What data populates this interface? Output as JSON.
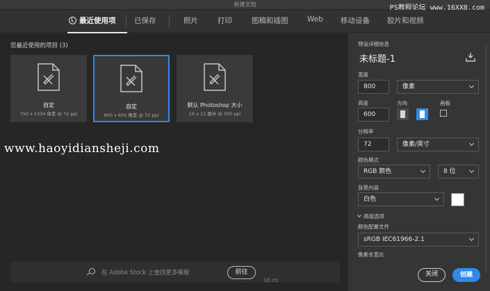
{
  "window": {
    "title": "新建文档"
  },
  "watermark_top": "PS教程论坛 www.16XX8.com",
  "tabs": [
    {
      "label": "最近使用项"
    },
    {
      "label": "已保存"
    },
    {
      "label": "照片"
    },
    {
      "label": "打印"
    },
    {
      "label": "图稿和插图"
    },
    {
      "label": "Web"
    },
    {
      "label": "移动设备"
    },
    {
      "label": "胶片和视频"
    }
  ],
  "recent": {
    "title": "您最近使用的项目 (3)",
    "items": [
      {
        "name": "自定",
        "meta": "750 x 1334 像素 @ 72 ppi"
      },
      {
        "name": "自定",
        "meta": "800 x 600 像素 @ 72 ppi"
      },
      {
        "name": "默认 Photoshop 大小",
        "meta": "16 x 12 厘米 @ 300 ppi"
      }
    ]
  },
  "watermark_mid": "www.haoyidiansheji.com",
  "search": {
    "placeholder": "在 Adobe Stock 上查找更多模板",
    "go_label": "前往"
  },
  "logo_mark": "UI.cn",
  "preset": {
    "section_label": "预设详细信息",
    "name": "未标题-1",
    "width_label": "宽度",
    "width_value": "800",
    "width_unit": "像素",
    "height_label": "高度",
    "height_value": "600",
    "orientation_label": "方向",
    "artboard_label": "画板",
    "resolution_label": "分辨率",
    "resolution_value": "72",
    "resolution_unit": "像素/英寸",
    "color_mode_label": "颜色模式",
    "color_mode_value": "RGB 颜色",
    "bit_depth_value": "8 位",
    "background_label": "背景内容",
    "background_value": "白色",
    "background_color": "#ffffff",
    "advanced_label": "高级选项",
    "color_profile_label": "颜色配置文件",
    "color_profile_value": "sRGB IEC61966-2.1",
    "pixel_aspect_label": "像素长宽比"
  },
  "actions": {
    "close_label": "关闭",
    "create_label": "创建"
  },
  "colors": {
    "accent": "#2f8ae8",
    "panel": "#353535",
    "main": "#262626"
  }
}
